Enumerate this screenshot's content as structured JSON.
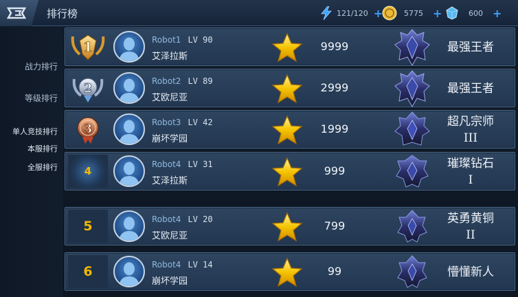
{
  "header": {
    "title": "排行榜",
    "resources": [
      {
        "icon": "lightning-icon",
        "value": "121/120"
      },
      {
        "icon": "gold-coin-icon",
        "value": "5775"
      },
      {
        "icon": "diamond-icon",
        "value": "600"
      }
    ]
  },
  "sidebar": {
    "items": [
      {
        "label": "战力排行"
      },
      {
        "label": "等级排行"
      },
      {
        "label": "单人竞技排行"
      },
      {
        "label": "本服排行"
      },
      {
        "label": "全服排行",
        "active": true
      }
    ]
  },
  "ranking": {
    "rows": [
      {
        "rank": "",
        "rank_badge": "gold-laurel-medal-1",
        "name": "Robot1",
        "lv": "LV 90",
        "school": "艾泽拉斯",
        "score": "9999",
        "tier_line1": "最强王者",
        "tier_line2": ""
      },
      {
        "rank": "",
        "rank_badge": "silver-laurel-medal-2",
        "name": "Robot2",
        "lv": "LV 89",
        "school": "艾欧尼亚",
        "score": "2999",
        "tier_line1": "最强王者",
        "tier_line2": ""
      },
      {
        "rank": "",
        "rank_badge": "bronze-medal-3",
        "name": "Robot3",
        "lv": "LV 42",
        "school": "崩坏学园",
        "score": "1999",
        "tier_line1": "超凡宗师",
        "tier_line2": "III"
      },
      {
        "rank": "4",
        "rank_badge": "glow-rank-4",
        "name": "Robot4",
        "lv": "LV 31",
        "school": "艾泽拉斯",
        "score": "999",
        "tier_line1": "璀璨钻石",
        "tier_line2": "I"
      },
      {
        "rank": "5",
        "rank_badge": "plain",
        "name": "Robot4",
        "lv": "LV 20",
        "school": "艾欧尼亚",
        "score": "799",
        "tier_line1": "英勇黄铜",
        "tier_line2": "II"
      },
      {
        "rank": "6",
        "rank_badge": "plain",
        "name": "Robot4",
        "lv": "LV 14",
        "school": "崩坏学园",
        "score": "99",
        "tier_line1": "懵懂新人",
        "tier_line2": ""
      }
    ]
  },
  "colors": {
    "accent_gold": "#f3c200",
    "plus_blue": "#3ea0ff",
    "row_bg": "#2f4660"
  }
}
